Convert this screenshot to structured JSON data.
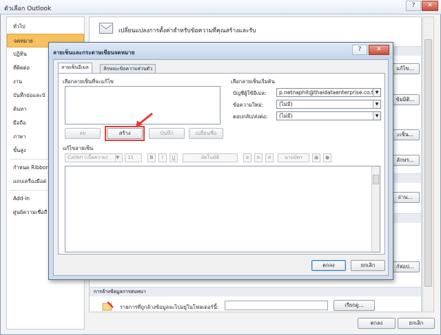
{
  "window": {
    "title": "ตัวเลือก Outlook",
    "help": "?",
    "close": "✕"
  },
  "sidebar": {
    "items": [
      {
        "label": "ทั่วไป"
      },
      {
        "label": "จดหมาย"
      },
      {
        "label": "ปฏิทิน"
      },
      {
        "label": "ที่ติดต่อ"
      },
      {
        "label": "งาน"
      },
      {
        "label": "บันทึกย่อและบั"
      },
      {
        "label": "ค้นหา"
      },
      {
        "label": "มือถือ"
      },
      {
        "label": "ภาษา"
      },
      {
        "label": "ขั้นสูง"
      },
      {
        "label": "กำหนด Ribbon"
      },
      {
        "label": "แถบเครื่องมือด่"
      },
      {
        "label": "Add-in"
      },
      {
        "label": "ศูนย์ความเชื่อถื"
      }
    ]
  },
  "main": {
    "header": "เปลี่ยนแปลงการตั้งค่าสำหรับข้อความที่คุณสร้างและรับ",
    "right_buttons": [
      "แก้ไข...",
      "ข้มมิติ...",
      "ะเซ็น...",
      "ลักษร...",
      "อ่าน...",
      "ก์ท่อป..."
    ],
    "section_cleanup": "การล้างข้อมูลการสนทนา",
    "cleanup_text": "รายการที่ถูกล้างข้อมูลจะไปอยู่ในโฟลเดอร์นี้:",
    "browse": "เรียกดู...",
    "ok": "ตกลง",
    "cancel": "ยกเลิก"
  },
  "dialog": {
    "title": "ลายเซ็นและกระดาษเขียนจดหมาย",
    "help": "?",
    "close": "✕",
    "tabs": [
      "ลายเซ็นอีเมล",
      "ลักษณะข้อความส่วนตัว"
    ],
    "select_label": "เลือกลายเซ็นที่จะแก้ไข",
    "default_label": "เลือกลายเซ็นเริ่มต้น",
    "account_label": "บัญชีผู้ใช้อีเมล:",
    "account_value": "p.netnaphit@thaidataenterprise.co.th",
    "new_msg_label": "ข้อความใหม่:",
    "new_msg_value": "(ไม่มี)",
    "reply_label": "ตอบกลับ/ส่งต่อ:",
    "reply_value": "(ไม่มี)",
    "buttons": {
      "delete": "ลบ",
      "new": "สร้าง",
      "save": "บันทึก",
      "rename": "เปลี่ยนชื่อ"
    },
    "edit_label": "แก้ไขลายเซ็น",
    "font": "Calibri (เนื้อความ)",
    "size": "11",
    "auto": "อัตโนมัติ",
    "business_card": "นามบัตร",
    "ok": "ตกลง",
    "cancel": "ยกเลิก"
  }
}
